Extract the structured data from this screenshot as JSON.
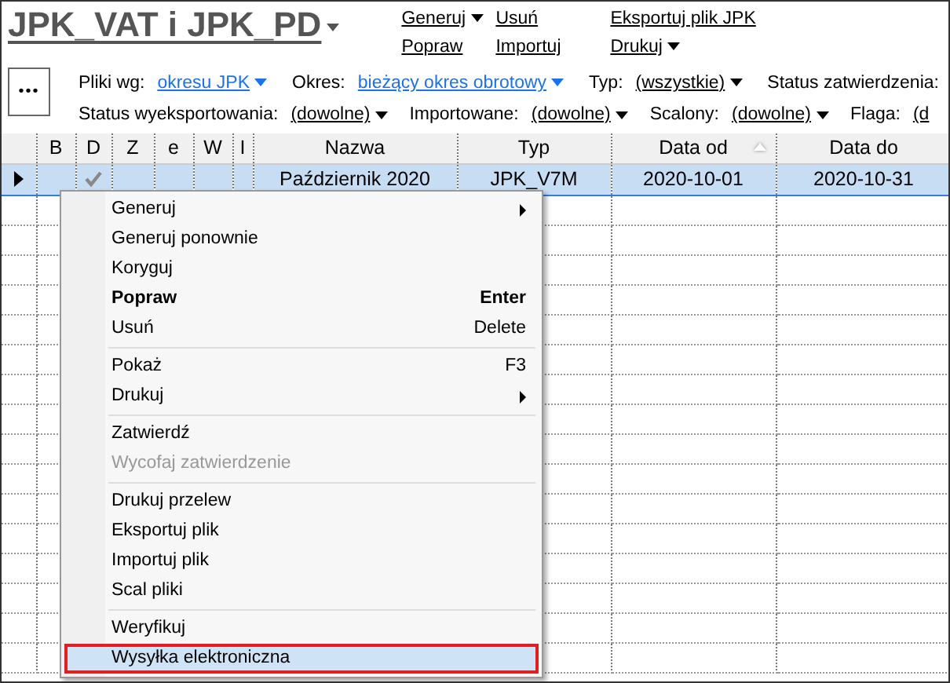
{
  "title": "JPK_VAT i JPK_PD",
  "actions": [
    {
      "label": "Generuj",
      "dropdown": true
    },
    {
      "label": "Popraw",
      "dropdown": false
    },
    {
      "label": "Usuń",
      "dropdown": false
    },
    {
      "label": "Importuj",
      "dropdown": false
    },
    {
      "label": "Eksportuj plik JPK",
      "dropdown": false
    },
    {
      "label": "Drukuj",
      "dropdown": true
    }
  ],
  "more_button": "•••",
  "filter_rows": [
    [
      {
        "label": "Pliki wg:",
        "value": "okresu JPK",
        "kind": "link"
      },
      {
        "label": "Okres:",
        "value": "bieżący okres obrotowy",
        "kind": "link"
      },
      {
        "label": "Typ:",
        "value": "(wszystkie)",
        "kind": "select"
      },
      {
        "label": "Status zatwierdzenia:",
        "kind": "label"
      }
    ],
    [
      {
        "label": "Status wyeksportowania:",
        "value": "(dowolne)",
        "kind": "select"
      },
      {
        "label": "Importowane:",
        "value": "(dowolne)",
        "kind": "select"
      },
      {
        "label": "Scalony:",
        "value": "(dowolne)",
        "kind": "select"
      },
      {
        "label": "Flaga:",
        "value": "(d",
        "kind": "cut"
      }
    ]
  ],
  "columns": [
    {
      "sorted": false
    },
    {
      "label": "B",
      "sorted": false
    },
    {
      "label": "D",
      "sorted": false
    },
    {
      "label": "Z",
      "sorted": false
    },
    {
      "label": "e",
      "sorted": false
    },
    {
      "label": "W",
      "sorted": false
    },
    {
      "label": "I",
      "sorted": false
    },
    {
      "label": "Nazwa",
      "sorted": false
    },
    {
      "label": "Typ",
      "sorted": false
    },
    {
      "label": "Data od",
      "sorted": true
    },
    {
      "label": "Data do",
      "sorted": false
    }
  ],
  "rows": [
    {
      "selected": true,
      "current": true,
      "checked_d": true,
      "nazwa": "Październik 2020",
      "typ": "JPK_V7M",
      "data_od": "2020-10-01",
      "data_do": "2020-10-31"
    }
  ],
  "menu": [
    {
      "kind": "item",
      "label": "Generuj",
      "submenu": true,
      "bold": false,
      "disabled": false,
      "highlighted": false
    },
    {
      "kind": "item",
      "label": "Generuj ponownie",
      "submenu": false,
      "bold": false,
      "disabled": false,
      "highlighted": false
    },
    {
      "kind": "item",
      "label": "Koryguj",
      "submenu": false,
      "bold": false,
      "disabled": false,
      "highlighted": false
    },
    {
      "kind": "item",
      "label": "Popraw",
      "shortcut": "Enter",
      "submenu": false,
      "bold": true,
      "disabled": false,
      "highlighted": false
    },
    {
      "kind": "item",
      "label": "Usuń",
      "shortcut": "Delete",
      "submenu": false,
      "bold": false,
      "disabled": false,
      "highlighted": false
    },
    {
      "kind": "separator"
    },
    {
      "kind": "item",
      "label": "Pokaż",
      "shortcut": "F3",
      "submenu": false,
      "bold": false,
      "disabled": false,
      "highlighted": false
    },
    {
      "kind": "item",
      "label": "Drukuj",
      "submenu": true,
      "bold": false,
      "disabled": false,
      "highlighted": false
    },
    {
      "kind": "separator"
    },
    {
      "kind": "item",
      "label": "Zatwierdź",
      "submenu": false,
      "bold": false,
      "disabled": false,
      "highlighted": false
    },
    {
      "kind": "item",
      "label": "Wycofaj zatwierdzenie",
      "submenu": false,
      "bold": false,
      "disabled": true,
      "highlighted": false
    },
    {
      "kind": "separator"
    },
    {
      "kind": "item",
      "label": "Drukuj przelew",
      "submenu": false,
      "bold": false,
      "disabled": false,
      "highlighted": false
    },
    {
      "kind": "item",
      "label": "Eksportuj plik",
      "submenu": false,
      "bold": false,
      "disabled": false,
      "highlighted": false
    },
    {
      "kind": "item",
      "label": "Importuj plik",
      "submenu": false,
      "bold": false,
      "disabled": false,
      "highlighted": false
    },
    {
      "kind": "item",
      "label": "Scal pliki",
      "submenu": false,
      "bold": false,
      "disabled": false,
      "highlighted": false
    },
    {
      "kind": "separator"
    },
    {
      "kind": "item",
      "label": "Weryfikuj",
      "submenu": false,
      "bold": false,
      "disabled": false,
      "highlighted": false
    },
    {
      "kind": "item",
      "label": "Wysyłka elektroniczna",
      "submenu": false,
      "bold": false,
      "disabled": false,
      "highlighted": true
    }
  ]
}
